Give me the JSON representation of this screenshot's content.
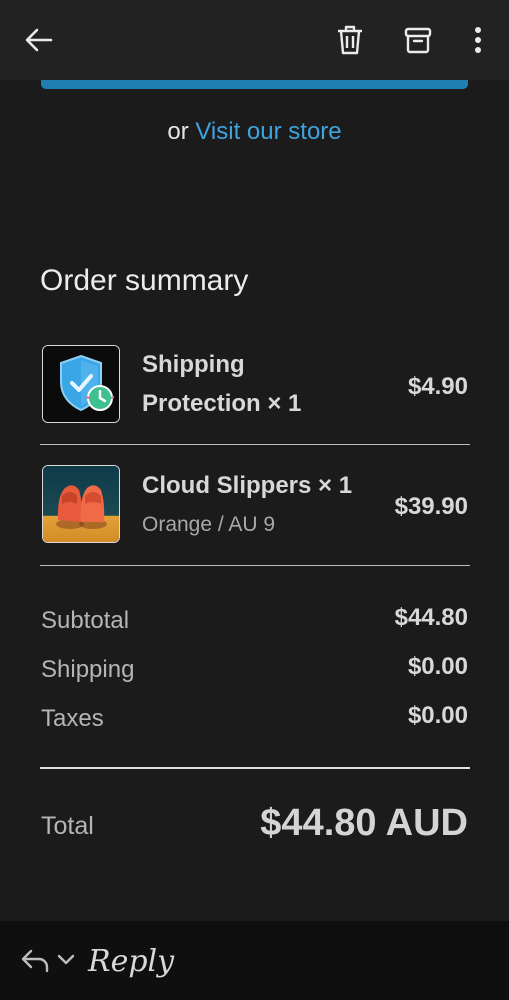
{
  "toolbar": {
    "back_icon": "arrow-left-icon",
    "delete_icon": "trash-icon",
    "archive_icon": "archive-icon",
    "more_icon": "more-vertical-icon"
  },
  "store": {
    "prefix": "or",
    "link_text": "Visit our store"
  },
  "order_summary": {
    "title": "Order summary",
    "items": [
      {
        "name_line1": "Shipping",
        "name_line2": "Protection × 1",
        "price": "$4.90",
        "icon": "shield-check-icon"
      },
      {
        "name_line1": "Cloud Slippers × 1",
        "variant": "Orange / AU 9",
        "price": "$39.90",
        "icon": "slippers-image"
      }
    ],
    "rows": [
      {
        "label": "Subtotal",
        "value": "$44.80"
      },
      {
        "label": "Shipping",
        "value": "$0.00"
      },
      {
        "label": "Taxes",
        "value": "$0.00"
      }
    ],
    "total": {
      "label": "Total",
      "value": "$44.80 AUD"
    }
  },
  "footer": {
    "reply_label": "Reply",
    "reply_icon": "reply-icon",
    "chevron_icon": "chevron-down-icon"
  },
  "colors": {
    "background": "#1b1b1b",
    "link": "#3fa3dd",
    "accent_bar": "#1f7fb3"
  }
}
